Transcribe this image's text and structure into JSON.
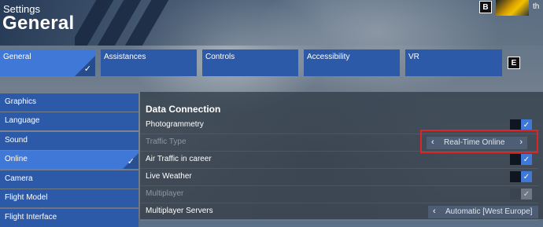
{
  "header": {
    "settings_label": "Settings",
    "title": "General",
    "left_key": "B",
    "tabs_key": "E",
    "profile_text": "th"
  },
  "tabs": [
    {
      "label": "General",
      "active": true
    },
    {
      "label": "Assistances",
      "active": false
    },
    {
      "label": "Controls",
      "active": false
    },
    {
      "label": "Accessibility",
      "active": false
    },
    {
      "label": "VR",
      "active": false
    }
  ],
  "sidebar": {
    "items": [
      {
        "label": "Graphics"
      },
      {
        "label": "Language"
      },
      {
        "label": "Sound"
      },
      {
        "label": "Online",
        "active": true
      },
      {
        "label": "Camera"
      },
      {
        "label": "Flight Model"
      },
      {
        "label": "Flight Interface"
      }
    ]
  },
  "panel": {
    "section_title": "Data Connection",
    "rows": [
      {
        "label": "Photogrammetry",
        "type": "toggle",
        "value": true,
        "enabled": true
      },
      {
        "label": "Traffic Type",
        "type": "selector",
        "value": "Real-Time Online",
        "enabled": false
      },
      {
        "label": "Air Traffic in career",
        "type": "toggle",
        "value": true,
        "enabled": true
      },
      {
        "label": "Live Weather",
        "type": "toggle",
        "value": true,
        "enabled": true
      },
      {
        "label": "Multiplayer",
        "type": "toggle",
        "value": true,
        "enabled": false
      },
      {
        "label": "Multiplayer Servers",
        "type": "selector",
        "value": "Automatic [West Europe]",
        "enabled": true
      }
    ]
  },
  "icons": {
    "check": "✓",
    "left_arrow": "‹",
    "right_arrow": "›"
  },
  "colors": {
    "accent": "#3f78d6",
    "tab": "#2d5aa8",
    "highlight": "#e02424"
  }
}
